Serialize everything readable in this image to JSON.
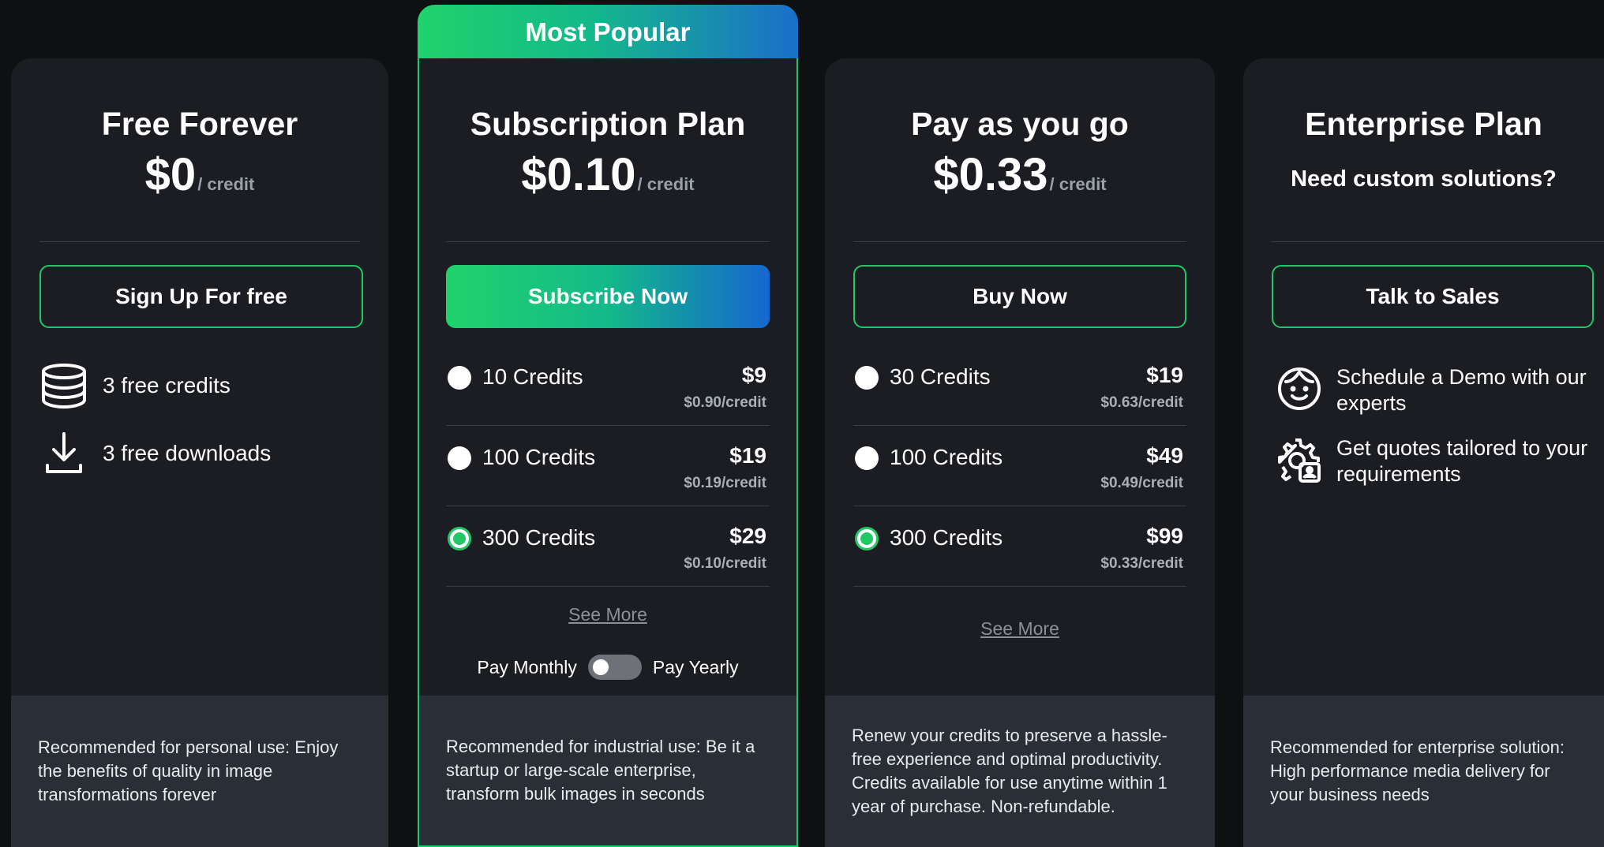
{
  "banner": {
    "label": "Most Popular"
  },
  "plans": {
    "free": {
      "title": "Free Forever",
      "price": "$0",
      "unit": "/ credit",
      "cta": "Sign Up For free",
      "features": [
        "3 free credits",
        "3 free downloads"
      ],
      "footer": "Recommended for personal use: Enjoy the benefits of quality in image transformations forever"
    },
    "subscription": {
      "title": "Subscription Plan",
      "price": "$0.10",
      "unit": "/ credit",
      "cta": "Subscribe Now",
      "options": [
        {
          "label": "10 Credits",
          "price": "$9",
          "per": "$0.90/credit",
          "selected": false
        },
        {
          "label": "100 Credits",
          "price": "$19",
          "per": "$0.19/credit",
          "selected": false
        },
        {
          "label": "300 Credits",
          "price": "$29",
          "per": "$0.10/credit",
          "selected": true
        }
      ],
      "see_more": "See More",
      "toggle_left": "Pay Monthly",
      "toggle_right": "Pay Yearly",
      "footer": "Recommended for industrial use: Be it a startup or large-scale enterprise, transform bulk images in seconds"
    },
    "payg": {
      "title": "Pay as you go",
      "price": "$0.33",
      "unit": "/ credit",
      "cta": "Buy Now",
      "options": [
        {
          "label": "30 Credits",
          "price": "$19",
          "per": "$0.63/credit",
          "selected": false
        },
        {
          "label": "100 Credits",
          "price": "$49",
          "per": "$0.49/credit",
          "selected": false
        },
        {
          "label": "300 Credits",
          "price": "$99",
          "per": "$0.33/credit",
          "selected": true
        }
      ],
      "see_more": "See More",
      "footer": "Renew your credits to preserve a hassle-free experience and optimal productivity. Credits available for use anytime within 1 year of purchase. Non-refundable."
    },
    "enterprise": {
      "title": "Enterprise Plan",
      "subtitle": "Need custom solutions?",
      "cta": "Talk to Sales",
      "features": [
        "Schedule a Demo with our experts",
        "Get quotes tailored to your requirements"
      ],
      "footer": "Recommended for enterprise solution: High performance media delivery for your business needs"
    }
  },
  "colors": {
    "accent_green": "#1fd36b",
    "accent_blue": "#1566cf",
    "card_bg": "#1b1d22",
    "footer_bg": "#2a2e36"
  }
}
